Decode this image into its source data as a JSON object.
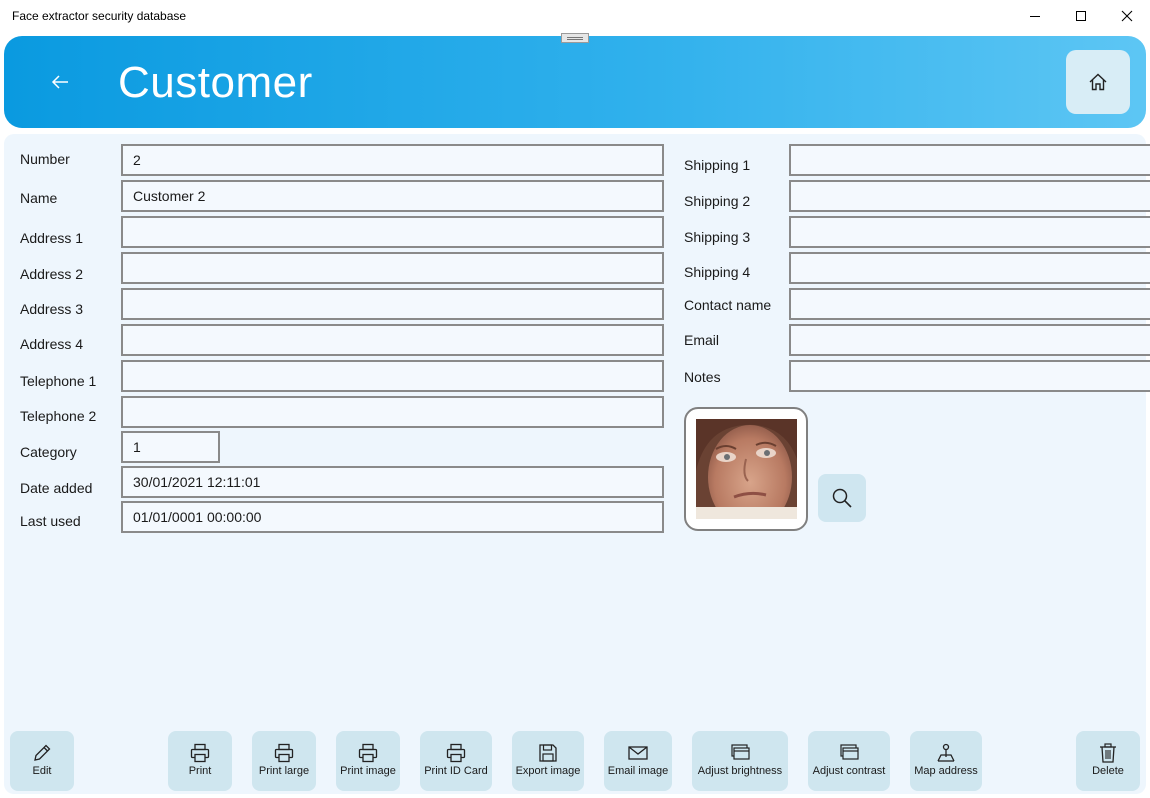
{
  "window": {
    "title": "Face extractor security database"
  },
  "header": {
    "title": "Customer"
  },
  "form_left": [
    {
      "key": "number",
      "label": "Number",
      "value": "2"
    },
    {
      "key": "name",
      "label": "Name",
      "value": "Customer 2"
    },
    {
      "key": "address1",
      "label": "Address 1",
      "value": ""
    },
    {
      "key": "address2",
      "label": "Address 2",
      "value": ""
    },
    {
      "key": "address3",
      "label": "Address 3",
      "value": ""
    },
    {
      "key": "address4",
      "label": "Address 4",
      "value": ""
    },
    {
      "key": "telephone1",
      "label": "Telephone 1",
      "value": ""
    },
    {
      "key": "telephone2",
      "label": "Telephone 2",
      "value": ""
    },
    {
      "key": "category",
      "label": "Category",
      "value": "1"
    },
    {
      "key": "date_added",
      "label": "Date added",
      "value": "30/01/2021 12:11:01"
    },
    {
      "key": "last_used",
      "label": "Last used",
      "value": "01/01/0001 00:00:00"
    }
  ],
  "form_right": [
    {
      "key": "shipping1",
      "label": "Shipping 1",
      "value": ""
    },
    {
      "key": "shipping2",
      "label": "Shipping 2",
      "value": ""
    },
    {
      "key": "shipping3",
      "label": "Shipping 3",
      "value": ""
    },
    {
      "key": "shipping4",
      "label": "Shipping 4",
      "value": ""
    },
    {
      "key": "contact_name",
      "label": "Contact name",
      "value": ""
    },
    {
      "key": "email",
      "label": "Email",
      "value": ""
    },
    {
      "key": "notes",
      "label": "Notes",
      "value": ""
    }
  ],
  "toolbar": {
    "edit": "Edit",
    "print": "Print",
    "print_large": "Print large",
    "print_image": "Print image",
    "print_id_card": "Print ID Card",
    "export_image": "Export image",
    "email_image": "Email image",
    "adjust_brightness": "Adjust brightness",
    "adjust_contrast": "Adjust contrast",
    "map_address": "Map address",
    "delete": "Delete"
  },
  "icons": {
    "back": "back-arrow-icon",
    "home": "home-icon",
    "search": "search-icon",
    "edit": "pencil-icon",
    "print": "printer-icon",
    "save": "save-icon",
    "email": "envelope-icon",
    "adjust": "stacked-windows-icon",
    "map": "map-pin-icon",
    "delete": "trash-icon"
  },
  "colors": {
    "header_start": "#0a9ae0",
    "header_end": "#5dc6f4",
    "panel_bg": "#eef6fd",
    "button_bg": "#cfe6ef",
    "input_border": "#8a8a8a"
  }
}
